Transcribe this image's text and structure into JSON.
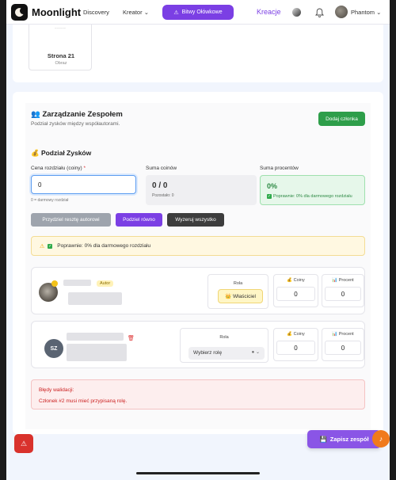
{
  "nav": {
    "brand": "Moonlight",
    "discovery": "Discovery",
    "kreator": "Kreator",
    "bitwy": "Bitwy Ołówkowe",
    "kreacje": "Kreacje",
    "user": "Phantom"
  },
  "gallery": {
    "page_title": "Strona 21",
    "page_type": "Obraz"
  },
  "team": {
    "title": "👥 Zarządzanie Zespołem",
    "subtitle": "Podział zysków między współautorami.",
    "add_button": "Dodaj członka"
  },
  "split": {
    "title": "💰 Podział Zysków",
    "price_label": "Cena rozdziału (coiny)",
    "price_required": "*",
    "price_value": "0",
    "price_hint": "0 = darmowy rozdział",
    "coins_label": "Suma coinów",
    "coins_value": "0 / 0",
    "coins_remaining": "Pozostało: 0",
    "pct_label": "Suma procentów",
    "pct_value": "0%",
    "pct_status": "Poprawnie: 0% dla darmowego rozdziału",
    "btn_assign": "Przydziel resztę autorowi",
    "btn_equal": "Podziel równo",
    "btn_clear": "Wyzeruj wszystko",
    "alert": "Poprawnie: 0% dla darmowego rozdziału"
  },
  "members": [
    {
      "badge": "Autor",
      "role_label": "Rola",
      "role": "👑 Właściciel",
      "coins_label": "💰 Coiny",
      "coins": "0",
      "pct_label": "📊 Procent",
      "pct": "0"
    },
    {
      "initials": "SZ",
      "role_label": "Rola",
      "role": "Wybierz rolę",
      "coins_label": "💰 Coiny",
      "coins": "0",
      "pct_label": "📊 Procent",
      "pct": "0"
    }
  ],
  "errors": {
    "title": "Błędy walidacji:",
    "message": "Członek #2 musi mieć przypisaną rolę."
  },
  "save_button": "Zapisz zespół",
  "colors": {
    "accent": "#7b3fe4",
    "success": "#2e9e4a",
    "danger": "#d9322c",
    "orange": "#f07a1c"
  }
}
